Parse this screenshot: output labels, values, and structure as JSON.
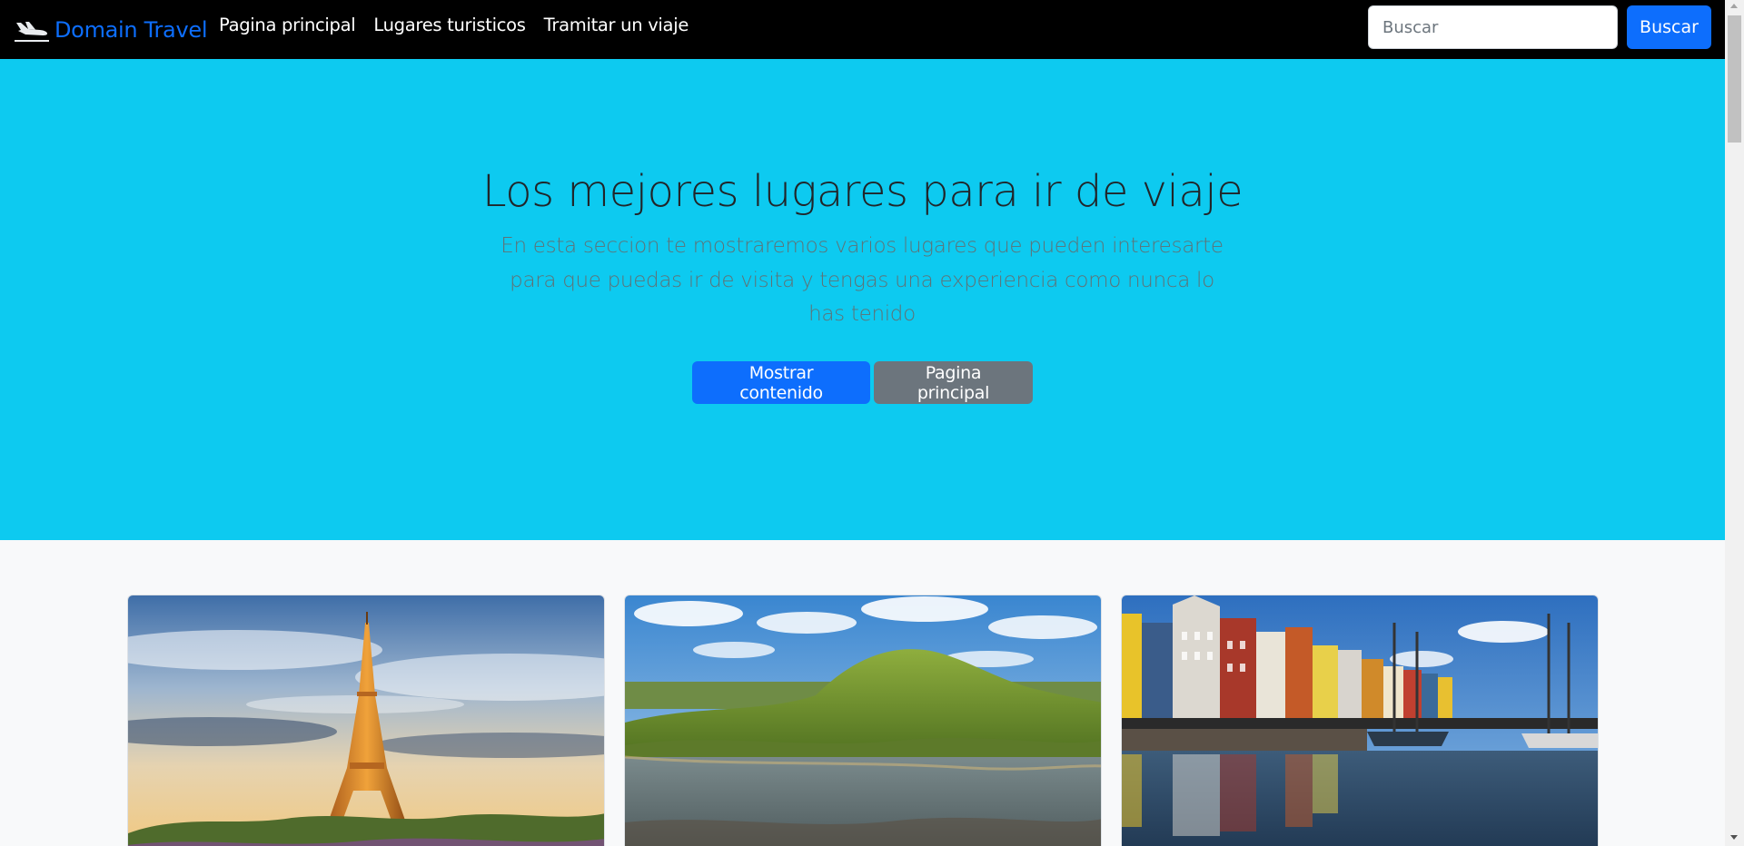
{
  "navbar": {
    "brand": "Domain Travel",
    "brand_icon": "airplane-landing-icon",
    "links": [
      "Pagina principal",
      "Lugares turisticos",
      "Tramitar un viaje"
    ],
    "search_placeholder": "Buscar",
    "search_button": "Buscar"
  },
  "hero": {
    "title": "Los mejores lugares para ir de viaje",
    "lead": "En esta seccion te mostraremos varios lugares que pueden interesarte para que puedas ir de visita y tengas una experiencia como nunca lo has tenido",
    "primary_button": "Mostrar contenido",
    "secondary_button": "Pagina principal"
  },
  "cards": [
    {
      "image": "eiffel-tower-paris-photo"
    },
    {
      "image": "green-hill-lake-landscape-photo"
    },
    {
      "image": "nyhavn-copenhagen-harbor-photo"
    }
  ],
  "colors": {
    "navbar_bg": "#000000",
    "brand": "#0d6efd",
    "hero_bg": "#0dcaf0",
    "primary": "#0d6efd",
    "secondary": "#6c757d",
    "page_bg": "#f8f9fa"
  }
}
